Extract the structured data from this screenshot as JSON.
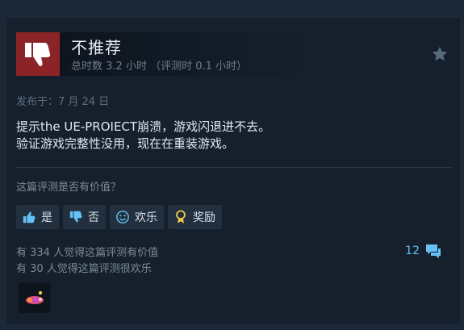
{
  "review": {
    "verdict": "不推荐",
    "hours": "总时数 3.2 小时 （评测时 0.1 小时）",
    "posted": "发布于：7 月 24 日",
    "body_lines": [
      "提示the UE-PROIECT崩溃，游戏闪退进不去。",
      "验证游戏完整性没用，现在在重装游戏。"
    ]
  },
  "feedback": {
    "question": "这篇评测是否有价值？",
    "buttons": [
      {
        "label": "是",
        "icon": "thumbs-up-icon"
      },
      {
        "label": "否",
        "icon": "thumbs-down-icon"
      },
      {
        "label": "欢乐",
        "icon": "smiley-icon"
      },
      {
        "label": "奖励",
        "icon": "award-ribbon-icon"
      }
    ]
  },
  "stats": {
    "helpful": "有 334 人觉得这篇评测有价值",
    "funny": "有 30 人觉得这篇评测很欢乐"
  },
  "comments": {
    "count": "12",
    "icon": "comment-bubble-icon"
  },
  "award_icon": "award-badge-icon",
  "colors": {
    "background": "#1b2838",
    "not_recommended": "#8c2427",
    "link": "#66c0f4"
  }
}
